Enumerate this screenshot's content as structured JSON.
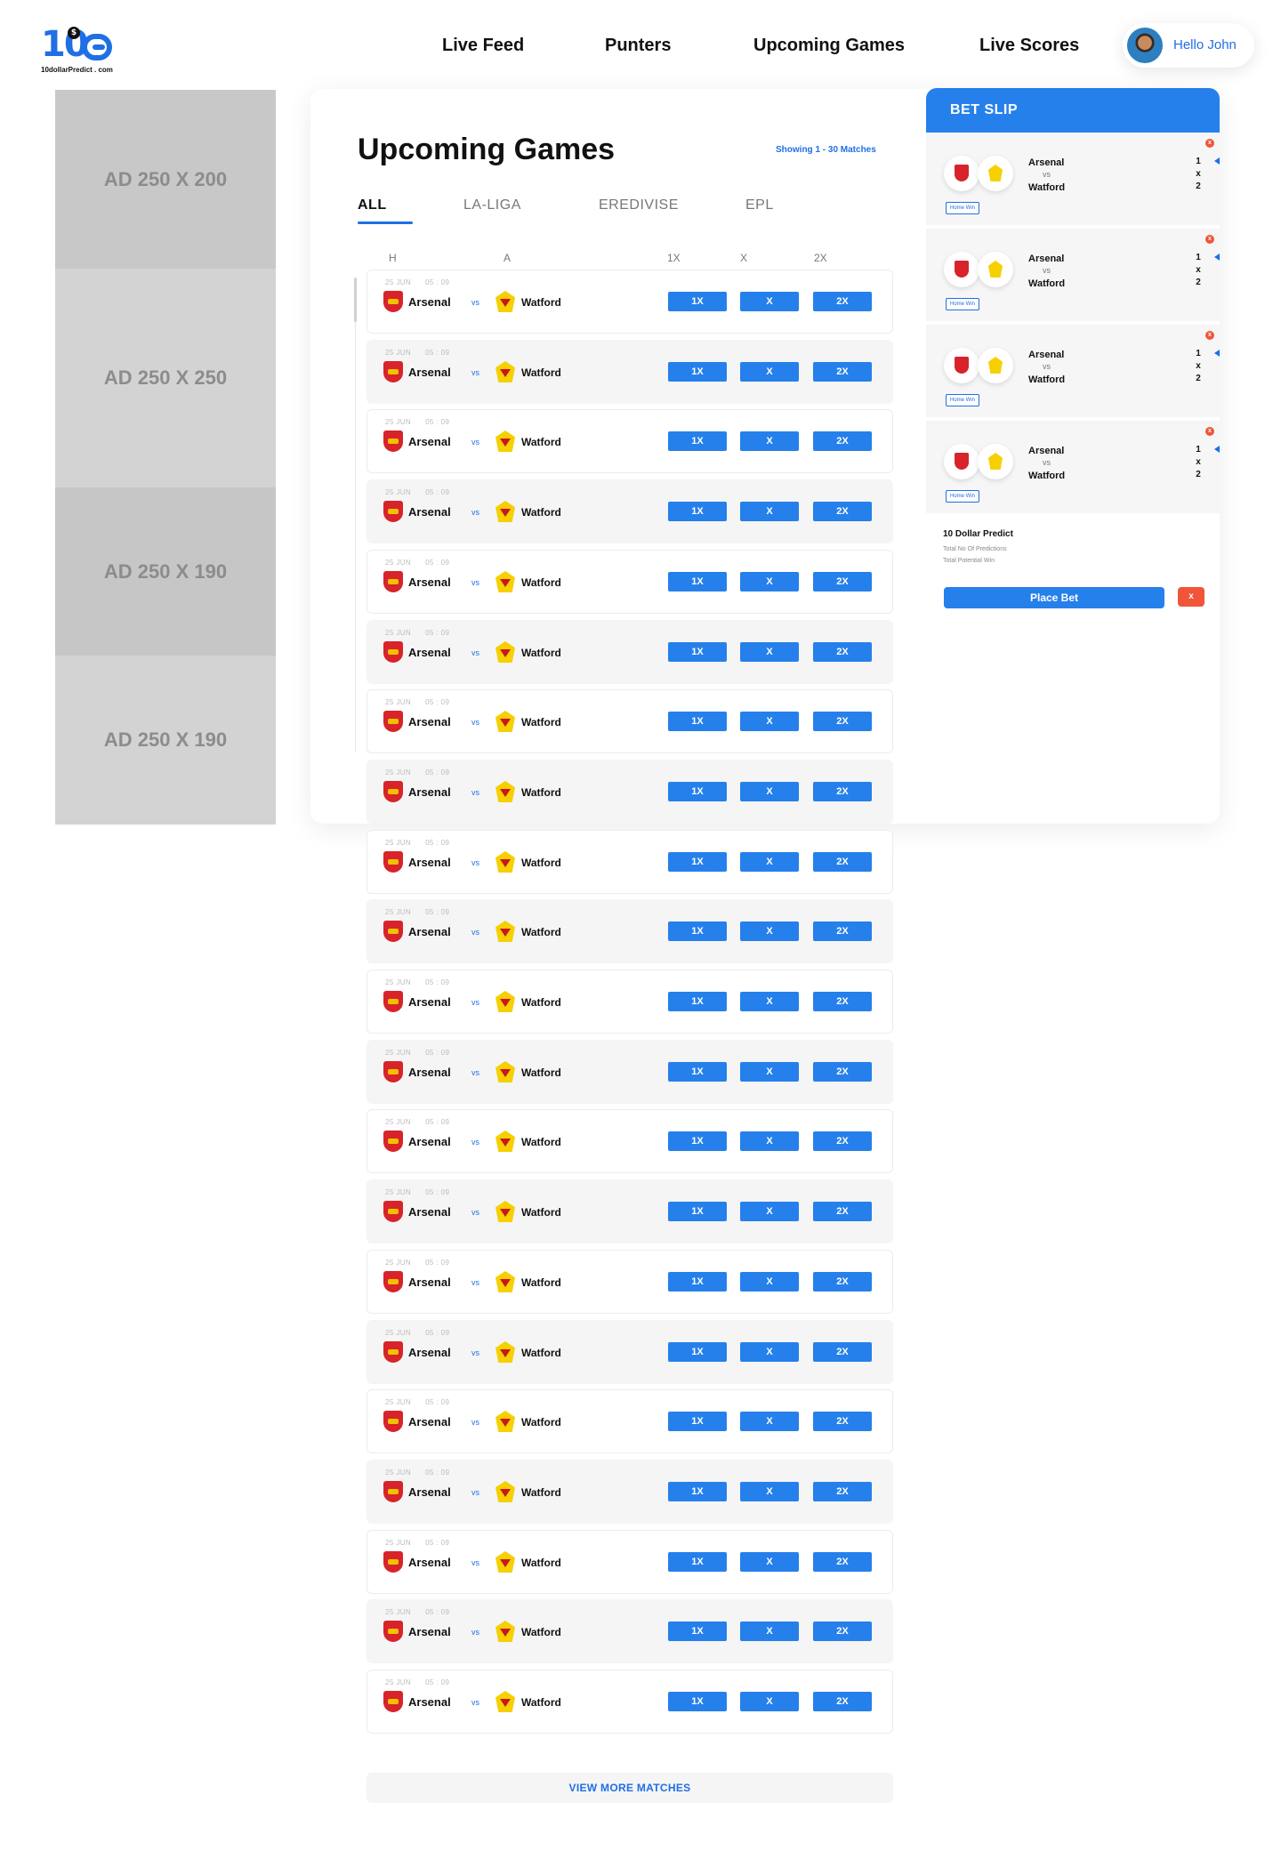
{
  "brand": {
    "logo_number": "10",
    "logo_badge": "$",
    "logo_text": "10dollarPredict . com"
  },
  "nav": {
    "items": [
      "Live Feed",
      "Punters",
      "Upcoming Games",
      "Live Scores"
    ],
    "user_greeting": "Hello John"
  },
  "ads": [
    "AD 250 X 200",
    "AD 250 X 250",
    "AD 250 X 190",
    "AD 250 X 190"
  ],
  "main": {
    "title": "Upcoming Games",
    "showing": "Showing 1 - 30 Matches",
    "tabs": [
      "ALL",
      "LA-LIGA",
      "EREDIVISE",
      "EPL"
    ],
    "active_tab": "ALL",
    "columns": [
      "H",
      "A",
      "1X",
      "X",
      "2X"
    ],
    "matches": [
      {
        "date": "25 JUN",
        "time": "05 : 09",
        "home": "Arsenal",
        "vs": "vs",
        "away": "Watford",
        "odds": [
          "1X",
          "X",
          "2X"
        ]
      },
      {
        "date": "25 JUN",
        "time": "05 : 09",
        "home": "Arsenal",
        "vs": "vs",
        "away": "Watford",
        "odds": [
          "1X",
          "X",
          "2X"
        ]
      },
      {
        "date": "25 JUN",
        "time": "05 : 09",
        "home": "Arsenal",
        "vs": "vs",
        "away": "Watford",
        "odds": [
          "1X",
          "X",
          "2X"
        ]
      },
      {
        "date": "25 JUN",
        "time": "05 : 09",
        "home": "Arsenal",
        "vs": "vs",
        "away": "Watford",
        "odds": [
          "1X",
          "X",
          "2X"
        ]
      },
      {
        "date": "25 JUN",
        "time": "05 : 09",
        "home": "Arsenal",
        "vs": "vs",
        "away": "Watford",
        "odds": [
          "1X",
          "X",
          "2X"
        ]
      },
      {
        "date": "25 JUN",
        "time": "05 : 09",
        "home": "Arsenal",
        "vs": "vs",
        "away": "Watford",
        "odds": [
          "1X",
          "X",
          "2X"
        ]
      },
      {
        "date": "25 JUN",
        "time": "05 : 09",
        "home": "Arsenal",
        "vs": "vs",
        "away": "Watford",
        "odds": [
          "1X",
          "X",
          "2X"
        ]
      },
      {
        "date": "25 JUN",
        "time": "05 : 09",
        "home": "Arsenal",
        "vs": "vs",
        "away": "Watford",
        "odds": [
          "1X",
          "X",
          "2X"
        ]
      },
      {
        "date": "25 JUN",
        "time": "05 : 09",
        "home": "Arsenal",
        "vs": "vs",
        "away": "Watford",
        "odds": [
          "1X",
          "X",
          "2X"
        ]
      },
      {
        "date": "25 JUN",
        "time": "05 : 09",
        "home": "Arsenal",
        "vs": "vs",
        "away": "Watford",
        "odds": [
          "1X",
          "X",
          "2X"
        ]
      },
      {
        "date": "25 JUN",
        "time": "05 : 09",
        "home": "Arsenal",
        "vs": "vs",
        "away": "Watford",
        "odds": [
          "1X",
          "X",
          "2X"
        ]
      },
      {
        "date": "25 JUN",
        "time": "05 : 09",
        "home": "Arsenal",
        "vs": "vs",
        "away": "Watford",
        "odds": [
          "1X",
          "X",
          "2X"
        ]
      },
      {
        "date": "25 JUN",
        "time": "05 : 09",
        "home": "Arsenal",
        "vs": "vs",
        "away": "Watford",
        "odds": [
          "1X",
          "X",
          "2X"
        ]
      },
      {
        "date": "25 JUN",
        "time": "05 : 09",
        "home": "Arsenal",
        "vs": "vs",
        "away": "Watford",
        "odds": [
          "1X",
          "X",
          "2X"
        ]
      },
      {
        "date": "25 JUN",
        "time": "05 : 09",
        "home": "Arsenal",
        "vs": "vs",
        "away": "Watford",
        "odds": [
          "1X",
          "X",
          "2X"
        ]
      },
      {
        "date": "25 JUN",
        "time": "05 : 09",
        "home": "Arsenal",
        "vs": "vs",
        "away": "Watford",
        "odds": [
          "1X",
          "X",
          "2X"
        ]
      },
      {
        "date": "25 JUN",
        "time": "05 : 09",
        "home": "Arsenal",
        "vs": "vs",
        "away": "Watford",
        "odds": [
          "1X",
          "X",
          "2X"
        ]
      },
      {
        "date": "25 JUN",
        "time": "05 : 09",
        "home": "Arsenal",
        "vs": "vs",
        "away": "Watford",
        "odds": [
          "1X",
          "X",
          "2X"
        ]
      },
      {
        "date": "25 JUN",
        "time": "05 : 09",
        "home": "Arsenal",
        "vs": "vs",
        "away": "Watford",
        "odds": [
          "1X",
          "X",
          "2X"
        ]
      },
      {
        "date": "25 JUN",
        "time": "05 : 09",
        "home": "Arsenal",
        "vs": "vs",
        "away": "Watford",
        "odds": [
          "1X",
          "X",
          "2X"
        ]
      },
      {
        "date": "25 JUN",
        "time": "05 : 09",
        "home": "Arsenal",
        "vs": "vs",
        "away": "Watford",
        "odds": [
          "1X",
          "X",
          "2X"
        ]
      }
    ],
    "view_more": "VIEW MORE MATCHES"
  },
  "bet_slip": {
    "title": "BET SLIP",
    "items": [
      {
        "home": "Arsenal",
        "vs": "vs",
        "away": "Watford",
        "odds": [
          "1",
          "x",
          "2"
        ],
        "tag": "Home Win",
        "close": "x"
      },
      {
        "home": "Arsenal",
        "vs": "vs",
        "away": "Watford",
        "odds": [
          "1",
          "x",
          "2"
        ],
        "tag": "Home Win",
        "close": "x"
      },
      {
        "home": "Arsenal",
        "vs": "vs",
        "away": "Watford",
        "odds": [
          "1",
          "x",
          "2"
        ],
        "tag": "Home Win",
        "close": "x"
      },
      {
        "home": "Arsenal",
        "vs": "vs",
        "away": "Watford",
        "odds": [
          "1",
          "x",
          "2"
        ],
        "tag": "Home Win",
        "close": "x"
      }
    ],
    "footer_title": "10 Dollar Predict",
    "footer_lines": [
      "Total No Of Predictions",
      "Total Potential Win"
    ],
    "place_bet": "Place Bet",
    "clear": "x"
  },
  "colors": {
    "accent": "#2680eb",
    "brand": "#1f6fe5",
    "danger": "#f0553a",
    "ad_gray": "#c8c8c8"
  }
}
